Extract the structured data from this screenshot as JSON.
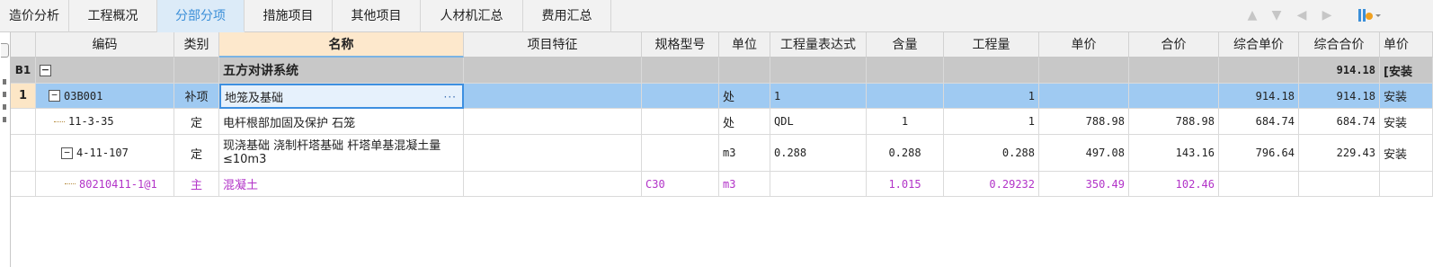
{
  "tabs": [
    {
      "label": "造价分析",
      "active": false
    },
    {
      "label": "工程概况",
      "active": false
    },
    {
      "label": "分部分项",
      "active": true
    },
    {
      "label": "措施项目",
      "active": false
    },
    {
      "label": "其他项目",
      "active": false
    },
    {
      "label": "人材机汇总",
      "active": false
    },
    {
      "label": "费用汇总",
      "active": false
    }
  ],
  "toolbar_icons": [
    "arrow-up-icon",
    "arrow-down-icon",
    "arrow-left-icon",
    "arrow-right-icon",
    "settings-icon"
  ],
  "columns": [
    "编码",
    "类别",
    "名称",
    "项目特征",
    "规格型号",
    "单位",
    "工程量表达式",
    "含量",
    "工程量",
    "单价",
    "合价",
    "综合单价",
    "综合合价",
    "单价"
  ],
  "rows": [
    {
      "num": "B1",
      "code": "",
      "type": "",
      "name": "五方对讲系统",
      "feature": "",
      "spec": "",
      "unit": "",
      "expr": "",
      "content": "",
      "qty": "",
      "price": "",
      "total": "",
      "comp_price": "",
      "comp_total": "914.18",
      "extra": "[安装"
    },
    {
      "num": "1",
      "code": "03B001",
      "type": "补项",
      "name": "地笼及基础",
      "feature": "",
      "spec": "",
      "unit": "处",
      "expr": "1",
      "content": "",
      "qty": "1",
      "price": "",
      "total": "",
      "comp_price": "914.18",
      "comp_total": "914.18",
      "extra": "安装"
    },
    {
      "num": "",
      "code": "11-3-35",
      "type": "定",
      "name": "电杆根部加固及保护 石笼",
      "feature": "",
      "spec": "",
      "unit": "处",
      "expr": "QDL",
      "content": "1",
      "qty": "1",
      "price": "788.98",
      "total": "788.98",
      "comp_price": "684.74",
      "comp_total": "684.74",
      "extra": "安装"
    },
    {
      "num": "",
      "code": "4-11-107",
      "type": "定",
      "name": "现浇基础 浇制杆塔基础 杆塔单基混凝土量≤10m3",
      "feature": "",
      "spec": "",
      "unit": "m3",
      "expr": "0.288",
      "content": "0.288",
      "qty": "0.288",
      "price": "497.08",
      "total": "143.16",
      "comp_price": "796.64",
      "comp_total": "229.43",
      "extra": "安装"
    },
    {
      "num": "",
      "code": "80210411-1@1",
      "type": "主",
      "name": "混凝土",
      "feature": "",
      "spec": "C30",
      "unit": "m3",
      "expr": "",
      "content": "1.015",
      "qty": "0.29232",
      "price": "350.49",
      "total": "102.46",
      "comp_price": "",
      "comp_total": "",
      "extra": ""
    }
  ],
  "colors": {
    "accent": "#3b8fd8",
    "selected_row": "#9fcaf2",
    "section_row": "#c8c8c8",
    "material_text": "#b233c8"
  }
}
